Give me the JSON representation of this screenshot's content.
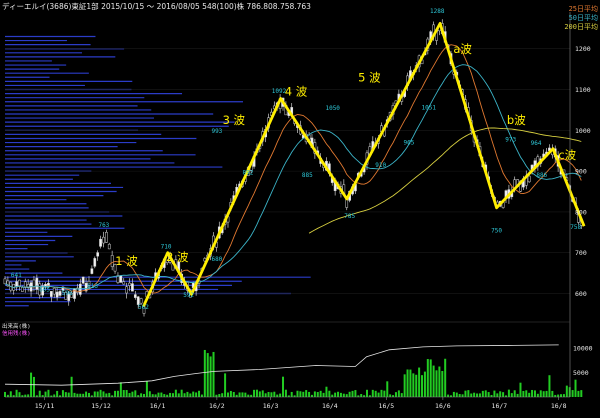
{
  "header": {
    "title": "ディーエルイ(3686)東証1部  2015/10/15 〜  2016/08/05  548(100)株  786.808.758.763"
  },
  "ma_legend": [
    {
      "label": "25日平均",
      "color": "#e07830"
    },
    {
      "label": "50日平均",
      "color": "#3bb4c8"
    },
    {
      "label": "200日平均",
      "color": "#d8d040"
    }
  ],
  "volume_labels": {
    "label1": "出来高(株)",
    "label2": "信用残(株)"
  },
  "chart_data": {
    "type": "line",
    "price_ylim": [
      540,
      1290
    ],
    "price_ticks": [
      600,
      700,
      800,
      900,
      1000,
      1100,
      1200
    ],
    "volume_ylim": [
      0,
      12000
    ],
    "volume_ticks": [
      5000,
      10000
    ],
    "x_range": [
      0,
      100
    ],
    "x_ticks": [
      {
        "x": 7,
        "label": "15/11"
      },
      {
        "x": 17,
        "label": "15/12"
      },
      {
        "x": 27,
        "label": "16/1"
      },
      {
        "x": 37.5,
        "label": "16/2"
      },
      {
        "x": 47,
        "label": "16/3"
      },
      {
        "x": 57.5,
        "label": "16/4"
      },
      {
        "x": 67.5,
        "label": "16/5"
      },
      {
        "x": 77.5,
        "label": "16/6"
      },
      {
        "x": 87.5,
        "label": "16/7"
      },
      {
        "x": 98,
        "label": "16/8"
      }
    ],
    "price_annotations": [
      {
        "x": 2,
        "y": 641,
        "label": "641"
      },
      {
        "x": 7,
        "y": 605,
        "label": "605"
      },
      {
        "x": 11,
        "y": 596,
        "label": "596"
      },
      {
        "x": 17.5,
        "y": 763,
        "label": "763"
      },
      {
        "x": 15.5,
        "y": 613,
        "label": "613"
      },
      {
        "x": 24.5,
        "y": 562,
        "label": "562"
      },
      {
        "x": 28.5,
        "y": 710,
        "label": "710"
      },
      {
        "x": 32.5,
        "y": 592,
        "label": "592"
      },
      {
        "x": 37.5,
        "y": 680,
        "label": "680"
      },
      {
        "x": 37.5,
        "y": 993,
        "label": "993"
      },
      {
        "x": 43,
        "y": 892,
        "label": "892"
      },
      {
        "x": 48.5,
        "y": 1092,
        "label": "1092"
      },
      {
        "x": 53.5,
        "y": 885,
        "label": "885"
      },
      {
        "x": 58,
        "y": 1050,
        "label": "1050"
      },
      {
        "x": 61,
        "y": 785,
        "label": "785"
      },
      {
        "x": 66.5,
        "y": 910,
        "label": "910"
      },
      {
        "x": 71.5,
        "y": 965,
        "label": "965"
      },
      {
        "x": 76.5,
        "y": 1288,
        "label": "1288"
      },
      {
        "x": 75,
        "y": 1051,
        "label": "1051"
      },
      {
        "x": 87,
        "y": 750,
        "label": "750"
      },
      {
        "x": 89.5,
        "y": 973,
        "label": "973"
      },
      {
        "x": 94,
        "y": 964,
        "label": "964"
      },
      {
        "x": 95,
        "y": 886,
        "label": "886"
      },
      {
        "x": 101,
        "y": 758,
        "label": "758"
      }
    ],
    "wave_line": [
      {
        "x": 24.5,
        "y": 568
      },
      {
        "x": 28.8,
        "y": 700
      },
      {
        "x": 33,
        "y": 598
      },
      {
        "x": 48.8,
        "y": 1078
      },
      {
        "x": 60.5,
        "y": 832
      },
      {
        "x": 77,
        "y": 1262
      },
      {
        "x": 87,
        "y": 810
      },
      {
        "x": 97,
        "y": 955
      },
      {
        "x": 102.5,
        "y": 765
      }
    ],
    "wave_labels": [
      {
        "x": 21.5,
        "y": 670,
        "label": "1 波"
      },
      {
        "x": 30.5,
        "y": 680,
        "label": "2 波"
      },
      {
        "x": 40.5,
        "y": 1015,
        "label": "3 波"
      },
      {
        "x": 51.5,
        "y": 1085,
        "label": "4 波"
      },
      {
        "x": 64.5,
        "y": 1120,
        "label": "5 波"
      },
      {
        "x": 81,
        "y": 1190,
        "label": "a波"
      },
      {
        "x": 90.5,
        "y": 1015,
        "label": "b波"
      },
      {
        "x": 99.5,
        "y": 930,
        "label": "c波"
      }
    ]
  }
}
